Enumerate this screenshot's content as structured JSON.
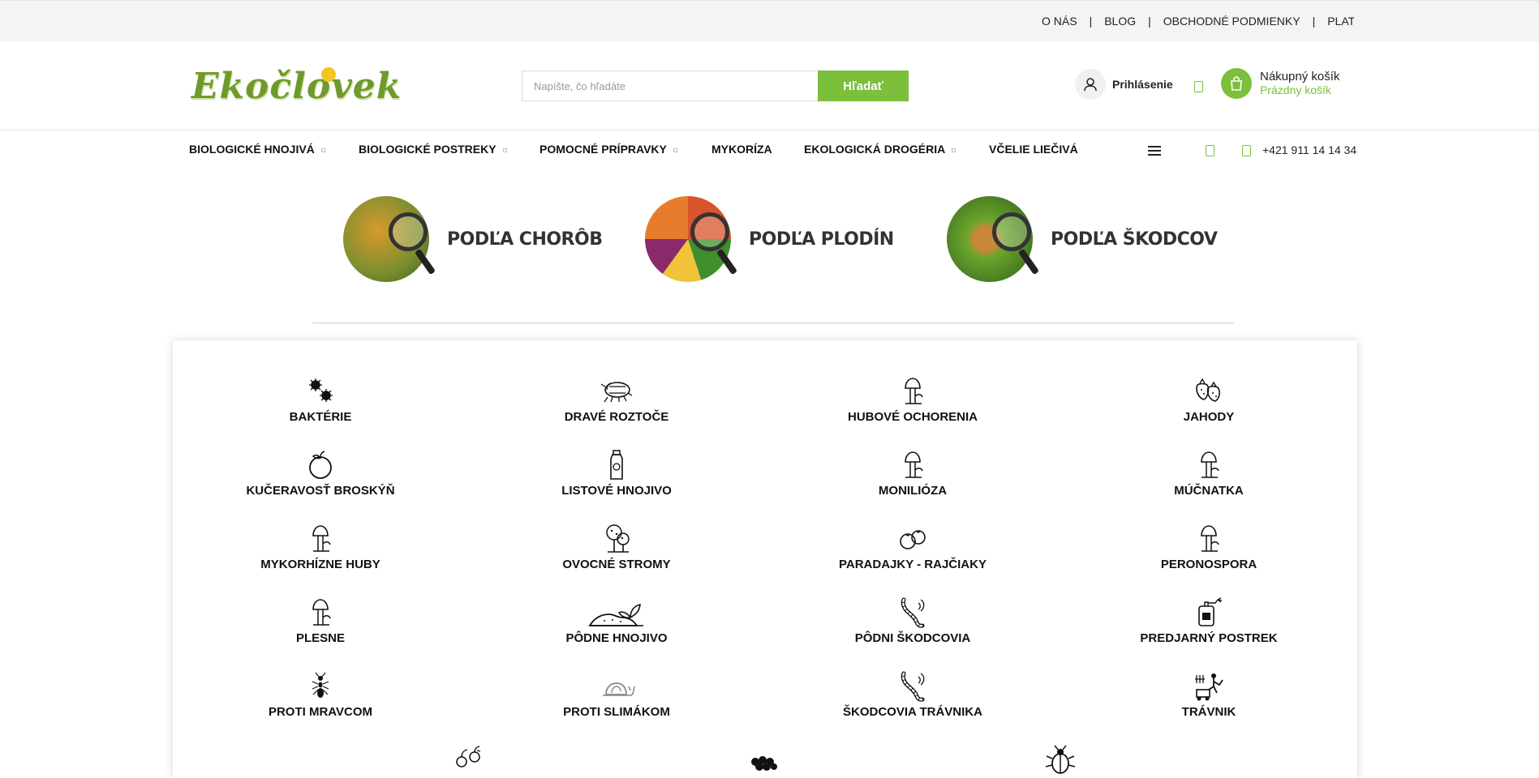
{
  "topbar": {
    "links": [
      "O NÁS",
      "BLOG",
      "OBCHODNÉ PODMIENKY",
      "PLAT"
    ],
    "separator": "|"
  },
  "header": {
    "logo_text": "Ekočlovek",
    "search": {
      "placeholder": "Napíšte, čo hľadáte",
      "value": "",
      "button_label": "Hľadať"
    },
    "login_label": "Prihlásenie",
    "cart": {
      "title": "Nákupný košík",
      "status": "Prázdny košík"
    }
  },
  "nav": {
    "items": [
      {
        "label": "BIOLOGICKÉ HNOJIVÁ",
        "has_submenu": true
      },
      {
        "label": "BIOLOGICKÉ POSTREKY",
        "has_submenu": true
      },
      {
        "label": "POMOCNÉ PRÍPRAVKY",
        "has_submenu": true
      },
      {
        "label": "MYKORÍZA",
        "has_submenu": false
      },
      {
        "label": "EKOLOGICKÁ DROGÉRIA",
        "has_submenu": true
      },
      {
        "label": "VČELIE LIEČIVÁ",
        "has_submenu": false
      }
    ],
    "phone": "+421 911 14 14 34"
  },
  "banners": [
    {
      "label": "PODĽA CHORÔB",
      "color": "#8a9a3a"
    },
    {
      "label": "PODĽA PLODÍN",
      "color": "#d9532b"
    },
    {
      "label": "PODĽA ŠKODCOV",
      "color": "#6aa52d"
    }
  ],
  "categories": [
    {
      "label": "BAKTÉRIE",
      "icon": "bacteria-icon"
    },
    {
      "label": "DRAVÉ ROZTOČE",
      "icon": "mite-icon"
    },
    {
      "label": "HUBOVÉ OCHORENIA",
      "icon": "mushroom-icon"
    },
    {
      "label": "JAHODY",
      "icon": "strawberry-icon"
    },
    {
      "label": "KUČERAVOSŤ BROSKÝŇ",
      "icon": "peach-icon"
    },
    {
      "label": "LISTOVÉ HNOJIVO",
      "icon": "bottle-icon"
    },
    {
      "label": "MONILIÓZA",
      "icon": "mushroom-icon"
    },
    {
      "label": "MÚČNATKA",
      "icon": "mushroom-icon"
    },
    {
      "label": "MYKORHÍZNE HUBY",
      "icon": "mushroom-icon"
    },
    {
      "label": "OVOCNÉ STROMY",
      "icon": "tree-icon"
    },
    {
      "label": "PARADAJKY - RAJČIAKY",
      "icon": "tomato-icon"
    },
    {
      "label": "PERONOSPORA",
      "icon": "mushroom-icon"
    },
    {
      "label": "PLESNE",
      "icon": "mushroom-icon"
    },
    {
      "label": "PÔDNE HNOJIVO",
      "icon": "soil-icon"
    },
    {
      "label": "PÔDNI ŠKODCOVIA",
      "icon": "grub-icon"
    },
    {
      "label": "PREDJARNÝ POSTREK",
      "icon": "sprayer-icon"
    },
    {
      "label": "PROTI MRAVCOM",
      "icon": "ant-icon"
    },
    {
      "label": "PROTI SLIMÁKOM",
      "icon": "snail-icon"
    },
    {
      "label": "ŠKODCOVIA TRÁVNIKA",
      "icon": "grub-icon"
    },
    {
      "label": "TRÁVNIK",
      "icon": "lawnmower-icon"
    }
  ],
  "partial_row_icons": [
    "seedling-icon",
    "berries-icon",
    "beetle-icon"
  ],
  "colors": {
    "accent": "#7bbf3b",
    "topbar_bg": "#f4f4f4"
  }
}
